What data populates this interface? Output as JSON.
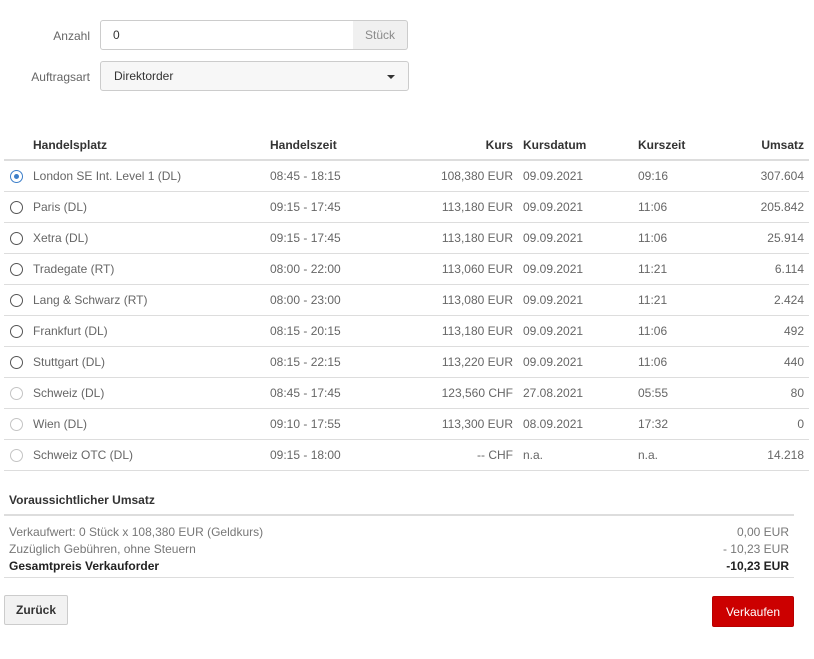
{
  "form": {
    "quantity_label": "Anzahl",
    "quantity_value": "0",
    "quantity_unit": "Stück",
    "order_type_label": "Auftragsart",
    "order_type_value": "Direktorder"
  },
  "table": {
    "headers": {
      "venue": "Handelsplatz",
      "trading_hours": "Handelszeit",
      "price": "Kurs",
      "price_date": "Kursdatum",
      "price_time": "Kurszeit",
      "volume": "Umsatz"
    },
    "rows": [
      {
        "venue": "London SE Int. Level 1 (DL)",
        "hours": "08:45 - 18:15",
        "price": "108,380 EUR",
        "date": "09.09.2021",
        "time": "09:16",
        "volume": "307.604",
        "state": "checked"
      },
      {
        "venue": "Paris (DL)",
        "hours": "09:15 - 17:45",
        "price": "113,180 EUR",
        "date": "09.09.2021",
        "time": "11:06",
        "volume": "205.842",
        "state": "enabled"
      },
      {
        "venue": "Xetra (DL)",
        "hours": "09:15 - 17:45",
        "price": "113,180 EUR",
        "date": "09.09.2021",
        "time": "11:06",
        "volume": "25.914",
        "state": "enabled"
      },
      {
        "venue": "Tradegate (RT)",
        "hours": "08:00 - 22:00",
        "price": "113,060 EUR",
        "date": "09.09.2021",
        "time": "11:21",
        "volume": "6.114",
        "state": "enabled"
      },
      {
        "venue": "Lang & Schwarz (RT)",
        "hours": "08:00 - 23:00",
        "price": "113,080 EUR",
        "date": "09.09.2021",
        "time": "11:21",
        "volume": "2.424",
        "state": "enabled"
      },
      {
        "venue": "Frankfurt (DL)",
        "hours": "08:15 - 20:15",
        "price": "113,180 EUR",
        "date": "09.09.2021",
        "time": "11:06",
        "volume": "492",
        "state": "enabled"
      },
      {
        "venue": "Stuttgart (DL)",
        "hours": "08:15 - 22:15",
        "price": "113,220 EUR",
        "date": "09.09.2021",
        "time": "11:06",
        "volume": "440",
        "state": "enabled"
      },
      {
        "venue": "Schweiz (DL)",
        "hours": "08:45 - 17:45",
        "price": "123,560 CHF",
        "date": "27.08.2021",
        "time": "05:55",
        "volume": "80",
        "state": "disabled"
      },
      {
        "venue": "Wien (DL)",
        "hours": "09:10 - 17:55",
        "price": "113,300 EUR",
        "date": "08.09.2021",
        "time": "17:32",
        "volume": "0",
        "state": "disabled"
      },
      {
        "venue": "Schweiz OTC (DL)",
        "hours": "09:15 - 18:00",
        "price": "-- CHF",
        "date": "n.a.",
        "time": "n.a.",
        "volume": "14.218",
        "state": "disabled"
      }
    ]
  },
  "summary": {
    "title": "Voraussichtlicher Umsatz",
    "sale_value_label": "Verkaufwert: 0 Stück x 108,380 EUR (Geldkurs)",
    "sale_value": "0,00 EUR",
    "fees_label": "Zuzüglich Gebühren, ohne Steuern",
    "fees_value": "- 10,23 EUR",
    "total_label": "Gesamtpreis Verkauforder",
    "total_value": "-10,23 EUR"
  },
  "buttons": {
    "back": "Zurück",
    "sell": "Verkaufen"
  },
  "colors": {
    "accent_blue": "#3d7fc9",
    "sell_red": "#cc0000"
  }
}
